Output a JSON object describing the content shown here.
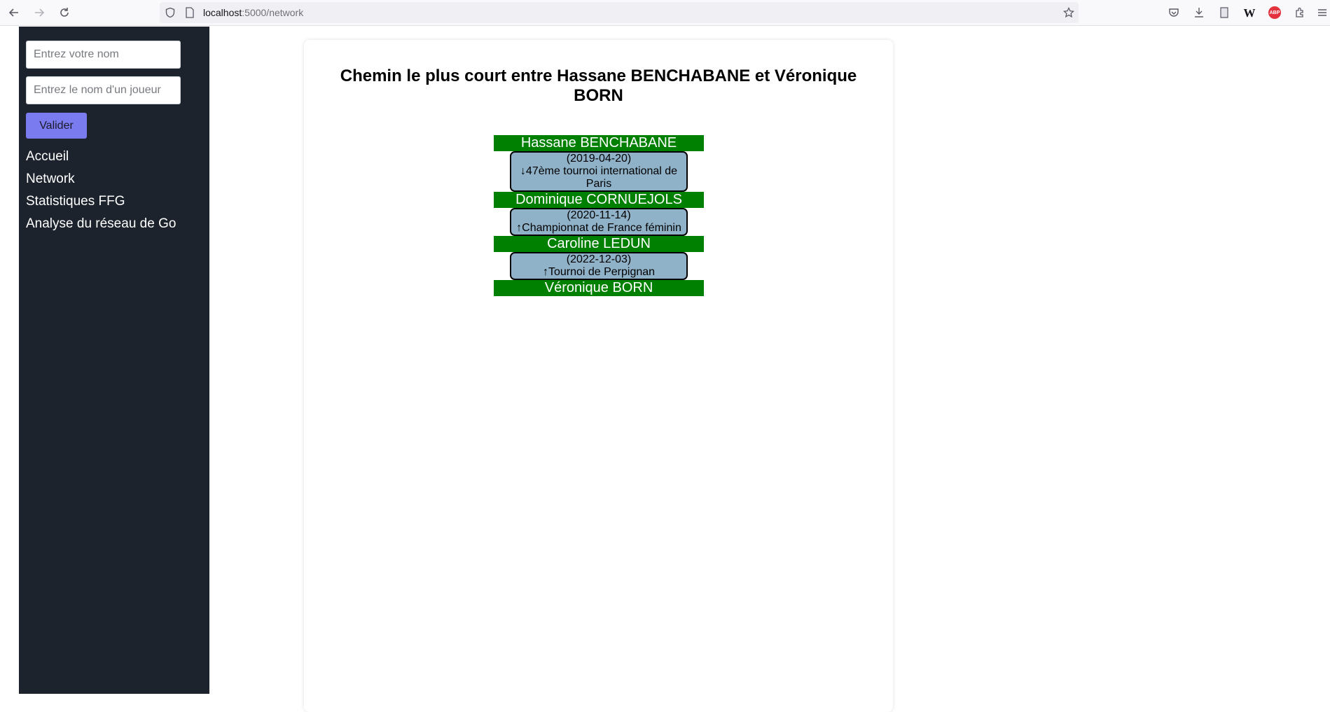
{
  "browser": {
    "url_host": "localhost",
    "url_path": ":5000/network",
    "icons": [
      "back-arrow-icon",
      "forward-arrow-icon",
      "reload-icon",
      "shield-icon",
      "page-icon",
      "star-icon",
      "pocket-icon",
      "download-icon",
      "reader-icon",
      "wikipedia-icon",
      "adblock-icon",
      "extensions-icon",
      "menu-icon"
    ],
    "wiki_label": "W",
    "abp_label": "ABP"
  },
  "sidebar": {
    "name_placeholder": "Entrez votre nom",
    "player_placeholder": "Entrez le nom d'un joueur",
    "validate_label": "Valider",
    "nav": [
      "Accueil",
      "Network",
      "Statistiques FFG",
      "Analyse du réseau de Go"
    ]
  },
  "main": {
    "title": "Chemin le plus court entre Hassane BENCHABANE et Véronique BORN",
    "path": [
      {
        "player": "Hassane BENCHABANE"
      },
      {
        "date": "(2019-04-20)",
        "tournament": "↓47ème tournoi international de Paris"
      },
      {
        "player": "Dominique CORNUEJOLS"
      },
      {
        "date": "(2020-11-14)",
        "tournament": "↑Championnat de France féminin"
      },
      {
        "player": "Caroline LEDUN"
      },
      {
        "date": "(2022-12-03)",
        "tournament": "↑Tournoi de Perpignan"
      },
      {
        "player": "Véronique BORN"
      }
    ]
  },
  "colors": {
    "sidebar_bg": "#1c232c",
    "button_bg": "#7b7bf0",
    "player_bg": "#008000",
    "game_bg": "#8fb2c8"
  }
}
